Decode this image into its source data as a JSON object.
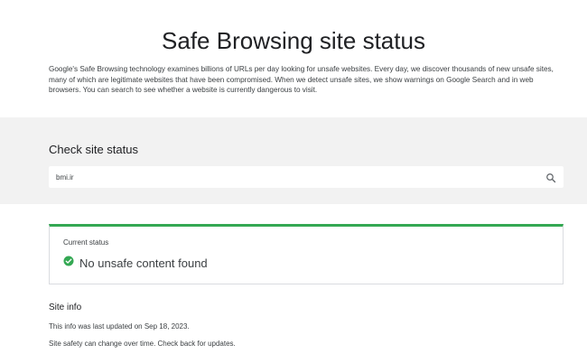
{
  "header": {
    "title": "Safe Browsing site status",
    "description": "Google's Safe Browsing technology examines billions of URLs per day looking for unsafe websites. Every day, we discover thousands of new unsafe sites, many of which are legitimate websites that have been compromised. When we detect unsafe sites, we show warnings on Google Search and in web browsers. You can search to see whether a website is currently dangerous to visit."
  },
  "check": {
    "heading": "Check site status",
    "search_value": "bmi.ir",
    "search_icon": "search-icon"
  },
  "status": {
    "label": "Current status",
    "result": "No unsafe content found",
    "icon": "check-circle-icon",
    "accent_color": "#34a853"
  },
  "site_info": {
    "heading": "Site info",
    "updated": "This info was last updated on Sep 18, 2023.",
    "note": "Site safety can change over time. Check back for updates."
  }
}
